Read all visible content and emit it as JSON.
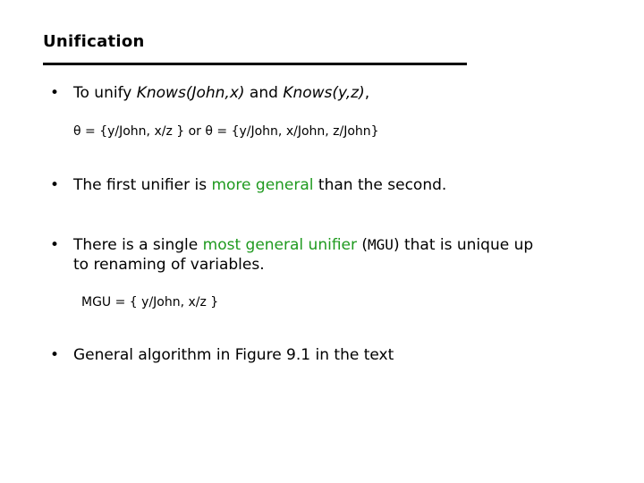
{
  "slide": {
    "title": "Unification",
    "accent_color": "#1f9a1f",
    "bullets": [
      {
        "marker": "•",
        "parts": [
          "To unify ",
          "Knows(John,x)",
          " and ",
          "Knows(y,z)",
          ","
        ]
      },
      {
        "marker": "•",
        "parts": [
          "The first unifier is ",
          "more general",
          " than the second."
        ]
      },
      {
        "marker": "•",
        "parts": [
          "There is a single ",
          "most general unifier",
          " (",
          "MGU",
          ") that is unique up"
        ],
        "line2": "to renaming of variables."
      },
      {
        "marker": "•",
        "parts": [
          "General algorithm in Figure 9.1 in the text"
        ]
      }
    ],
    "theta_line": "θ = {y/John,  x/z } or θ = {y/John, x/John,  z/John}",
    "mgu_line": "MGU = { y/John, x/z }"
  }
}
